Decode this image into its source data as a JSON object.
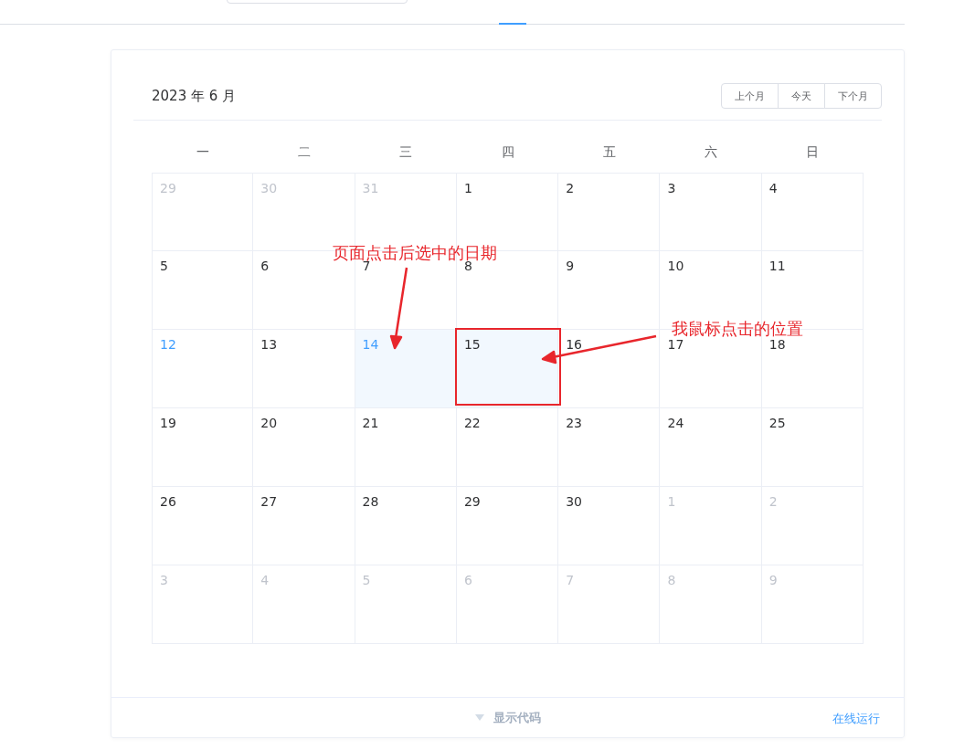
{
  "calendar": {
    "title": "2023 年 6 月",
    "buttons": [
      "上个月",
      "今天",
      "下个月"
    ],
    "weekdays": [
      "一",
      "二",
      "三",
      "四",
      "五",
      "六",
      "日"
    ],
    "days": [
      [
        {
          "day": "29",
          "kind": "other",
          "selected": false,
          "hovered": false
        },
        {
          "day": "30",
          "kind": "other",
          "selected": false,
          "hovered": false
        },
        {
          "day": "31",
          "kind": "other",
          "selected": false,
          "hovered": false
        },
        {
          "day": "1",
          "kind": "day",
          "selected": false,
          "hovered": false
        },
        {
          "day": "2",
          "kind": "day",
          "selected": false,
          "hovered": false
        },
        {
          "day": "3",
          "kind": "day",
          "selected": false,
          "hovered": false
        },
        {
          "day": "4",
          "kind": "day",
          "selected": false,
          "hovered": false
        }
      ],
      [
        {
          "day": "5",
          "kind": "day",
          "selected": false,
          "hovered": false
        },
        {
          "day": "6",
          "kind": "day",
          "selected": false,
          "hovered": false
        },
        {
          "day": "7",
          "kind": "day",
          "selected": false,
          "hovered": false
        },
        {
          "day": "8",
          "kind": "day",
          "selected": false,
          "hovered": false
        },
        {
          "day": "9",
          "kind": "day",
          "selected": false,
          "hovered": false
        },
        {
          "day": "10",
          "kind": "day",
          "selected": false,
          "hovered": false
        },
        {
          "day": "11",
          "kind": "day",
          "selected": false,
          "hovered": false
        }
      ],
      [
        {
          "day": "12",
          "kind": "today",
          "selected": false,
          "hovered": false
        },
        {
          "day": "13",
          "kind": "day",
          "selected": false,
          "hovered": false
        },
        {
          "day": "14",
          "kind": "day",
          "selected": true,
          "hovered": false
        },
        {
          "day": "15",
          "kind": "day",
          "selected": false,
          "hovered": true
        },
        {
          "day": "16",
          "kind": "day",
          "selected": false,
          "hovered": false
        },
        {
          "day": "17",
          "kind": "day",
          "selected": false,
          "hovered": false
        },
        {
          "day": "18",
          "kind": "day",
          "selected": false,
          "hovered": false
        }
      ],
      [
        {
          "day": "19",
          "kind": "day",
          "selected": false,
          "hovered": false
        },
        {
          "day": "20",
          "kind": "day",
          "selected": false,
          "hovered": false
        },
        {
          "day": "21",
          "kind": "day",
          "selected": false,
          "hovered": false
        },
        {
          "day": "22",
          "kind": "day",
          "selected": false,
          "hovered": false
        },
        {
          "day": "23",
          "kind": "day",
          "selected": false,
          "hovered": false
        },
        {
          "day": "24",
          "kind": "day",
          "selected": false,
          "hovered": false
        },
        {
          "day": "25",
          "kind": "day",
          "selected": false,
          "hovered": false
        }
      ],
      [
        {
          "day": "26",
          "kind": "day",
          "selected": false,
          "hovered": false
        },
        {
          "day": "27",
          "kind": "day",
          "selected": false,
          "hovered": false
        },
        {
          "day": "28",
          "kind": "day",
          "selected": false,
          "hovered": false
        },
        {
          "day": "29",
          "kind": "day",
          "selected": false,
          "hovered": false
        },
        {
          "day": "30",
          "kind": "day",
          "selected": false,
          "hovered": false
        },
        {
          "day": "1",
          "kind": "other",
          "selected": false,
          "hovered": false
        },
        {
          "day": "2",
          "kind": "other",
          "selected": false,
          "hovered": false
        }
      ],
      [
        {
          "day": "3",
          "kind": "other",
          "selected": false,
          "hovered": false
        },
        {
          "day": "4",
          "kind": "other",
          "selected": false,
          "hovered": false
        },
        {
          "day": "5",
          "kind": "other",
          "selected": false,
          "hovered": false
        },
        {
          "day": "6",
          "kind": "other",
          "selected": false,
          "hovered": false
        },
        {
          "day": "7",
          "kind": "other",
          "selected": false,
          "hovered": false
        },
        {
          "day": "8",
          "kind": "other",
          "selected": false,
          "hovered": false
        },
        {
          "day": "9",
          "kind": "other",
          "selected": false,
          "hovered": false
        }
      ]
    ]
  },
  "annotations": [
    "页面点击后选中的日期",
    "我鼠标点击的位置"
  ],
  "footer": {
    "toggle": "显示代码",
    "run_link": "在线运行"
  }
}
